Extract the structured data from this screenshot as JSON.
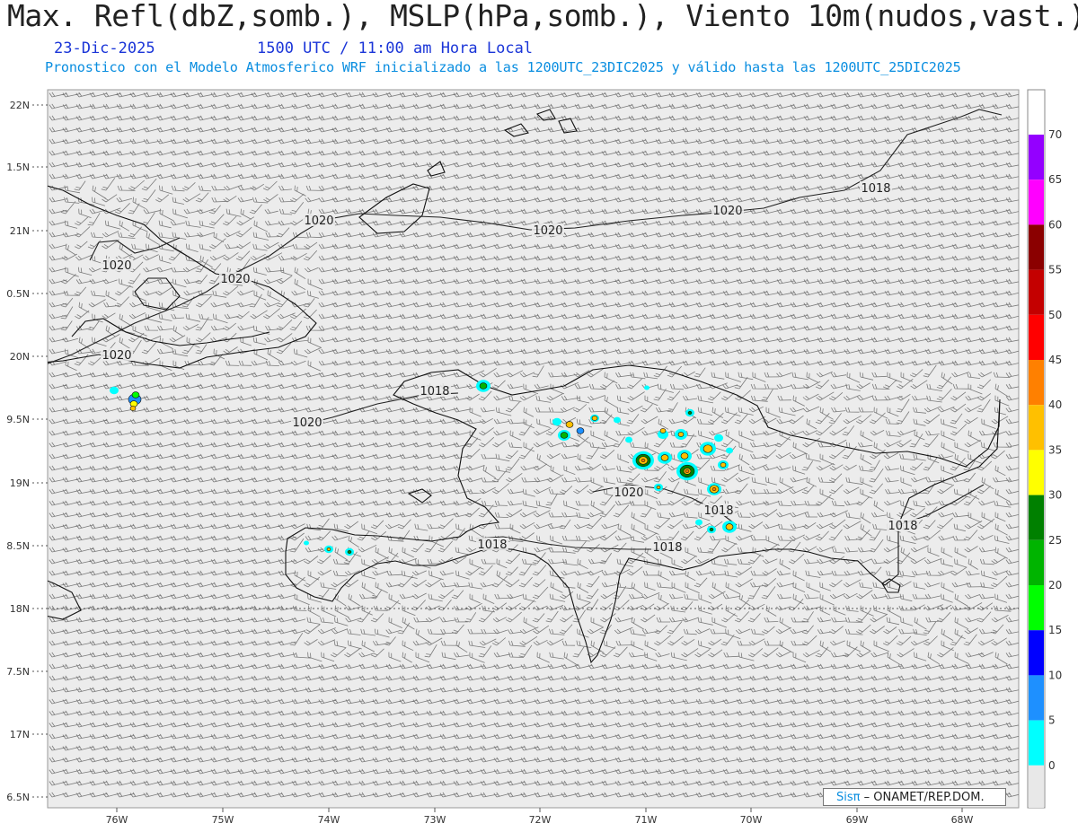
{
  "header": {
    "title": "Max. Refl(dbZ,somb.), MSLP(hPa,somb.), Viento 10m(nudos,vast.)",
    "date": "23-Dic-2025",
    "time": "1500 UTC / 11:00 am Hora Local",
    "description": "Pronostico con el Modelo Atmosferico WRF inicializado a las 1200UTC_23DIC2025 y válido hasta las  1200UTC_25DIC2025"
  },
  "axes": {
    "y_ticks": [
      "22N",
      "1.5N",
      "21N",
      "0.5N",
      "20N",
      "9.5N",
      "19N",
      "8.5N",
      "18N",
      "7.5N",
      "17N",
      "6.5N"
    ],
    "x_ticks": [
      "76W",
      "75W",
      "74W",
      "73W",
      "72W",
      "71W",
      "70W",
      "69W",
      "68W"
    ]
  },
  "isobars": [
    {
      "label": "1020"
    },
    {
      "label": "1020"
    },
    {
      "label": "1020"
    },
    {
      "label": "1020"
    },
    {
      "label": "1020"
    },
    {
      "label": "1020"
    },
    {
      "label": "1018"
    },
    {
      "label": "1018"
    },
    {
      "label": "1020"
    },
    {
      "label": "1020"
    },
    {
      "label": "1018"
    },
    {
      "label": "1018"
    },
    {
      "label": "1018"
    },
    {
      "label": "1018"
    }
  ],
  "colorbar": {
    "labels": [
      "70",
      "65",
      "60",
      "55",
      "50",
      "45",
      "40",
      "35",
      "30",
      "25",
      "20",
      "15",
      "10",
      "5",
      "0"
    ],
    "colors": [
      "#9400ff",
      "#ff00ff",
      "#8b0000",
      "#c40000",
      "#ff0000",
      "#ff8000",
      "#ffc000",
      "#ffff00",
      "#008000",
      "#00b400",
      "#00ff00",
      "#0000ff",
      "#1e90ff",
      "#00ffff",
      "#e8e8e8"
    ]
  },
  "credit": {
    "sis": "Sisπ",
    "org": "– ONAMET/REP.DOM."
  }
}
